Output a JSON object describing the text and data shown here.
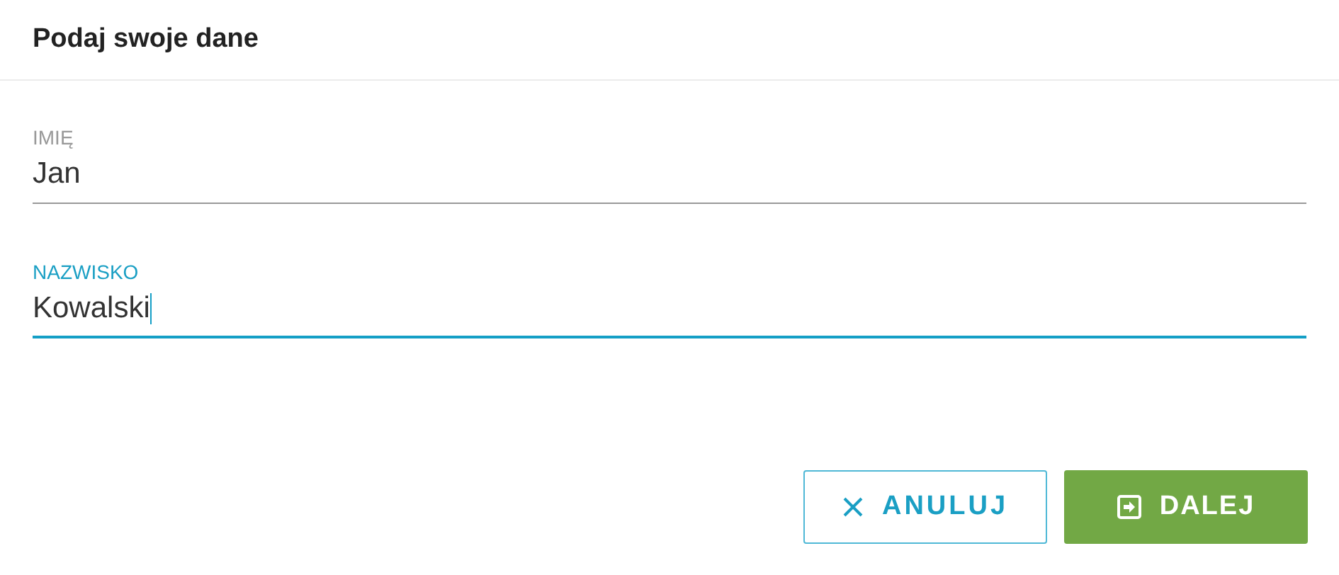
{
  "dialog": {
    "title": "Podaj swoje dane"
  },
  "fields": [
    {
      "label": "IMIĘ",
      "value": "Jan",
      "focused": false
    },
    {
      "label": "NAZWISKO",
      "value": "Kowalski",
      "focused": true
    }
  ],
  "buttons": [
    {
      "kind": "cancel",
      "label": "ANULUJ"
    },
    {
      "kind": "next",
      "label": "DALEJ"
    }
  ]
}
